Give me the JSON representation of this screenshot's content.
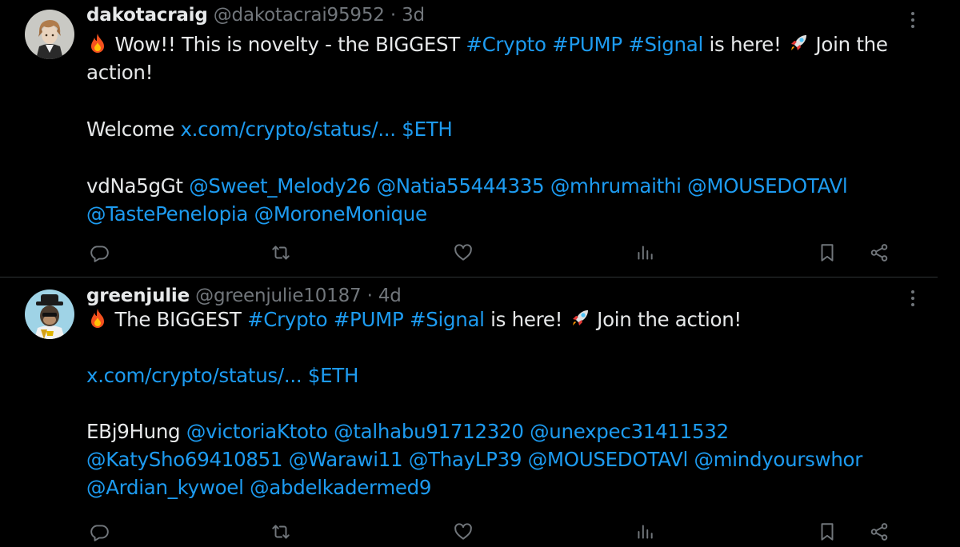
{
  "colors": {
    "background": "#000000",
    "text": "#e7e9ea",
    "muted": "#71767b",
    "link": "#1d9bf0",
    "divider": "#2f3336"
  },
  "tweets": [
    {
      "display_name": "dakotacraig",
      "handle": "@dakotacrai95952",
      "separator": "·",
      "time": "3d",
      "avatar": "anime-character-avatar",
      "text": {
        "l1_part1": "Wow!! This is novelty - the BIGGEST",
        "l1_tag1": "#Crypto",
        "l1_tag2": "#PUMP",
        "l1_tag3": "#Signal",
        "l1_part2": "is here!",
        "l1_part3": "Join the",
        "l2": "action!",
        "l3_word": "Welcome",
        "l3_link": "x.com/crypto/status/...",
        "l3_cashtag": "$ETH",
        "l4_code": "vdNa5gGt",
        "l4_mentions": [
          "@Sweet_Melody26",
          "@Natia55444335",
          "@mhrumaithi",
          "@MOUSEDOTAVl"
        ],
        "l5_mentions": [
          "@TastePenelopia",
          "@MoroneMonique"
        ]
      }
    },
    {
      "display_name": "greenjulie",
      "handle": "@greenjulie10187",
      "separator": "·",
      "time": "4d",
      "avatar": "ape-nft-avatar",
      "text": {
        "l1_part1": "The BIGGEST",
        "l1_tag1": "#Crypto",
        "l1_tag2": "#PUMP",
        "l1_tag3": "#Signal",
        "l1_part2": "is here!",
        "l1_part3": "Join the action!",
        "l2_link": "x.com/crypto/status/...",
        "l2_cashtag": "$ETH",
        "l3_code": "EBj9Hung",
        "l3_mentions": [
          "@victoriaKtoto",
          "@talhabu91712320",
          "@unexpec31411532"
        ],
        "l4_mentions": [
          "@KatySho69410851",
          "@Warawi11",
          "@ThayLP39",
          "@MOUSEDOTAVl",
          "@mindyourswhor"
        ],
        "l5_mentions": [
          "@Ardian_kywoel",
          "@abdelkadermed9"
        ]
      }
    }
  ],
  "actions": [
    "reply-icon",
    "repost-icon",
    "like-icon",
    "views-icon",
    "bookmark-icon",
    "share-icon"
  ]
}
